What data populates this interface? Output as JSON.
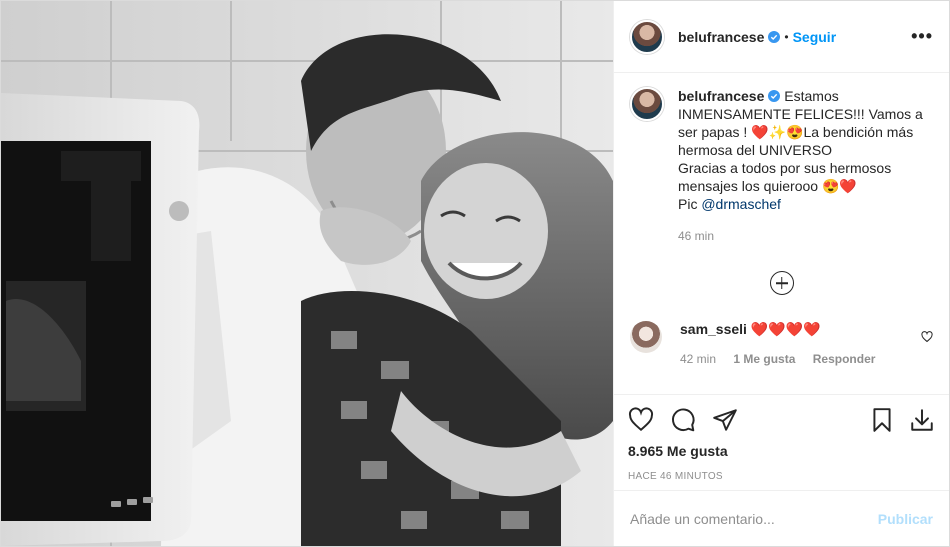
{
  "post": {
    "username": "belufrancese",
    "follow_label": "Seguir",
    "separator": "•",
    "more_icon": "more-horizontal-icon",
    "caption": {
      "username": "belufrancese",
      "text_part1": " Estamos INMENSAMENTE FELICES!!! Vamos a ser papas ! ",
      "emoji1": "❤️✨😍",
      "text_part2": "La bendición más hermosa del UNIVERSO\nGracias a todos por sus hermosos mensajes los quierooo ",
      "emoji2": "😍❤️",
      "pic_label": "\nPic ",
      "mention": "@drmaschef",
      "time": "46 min"
    },
    "comments": [
      {
        "username": "sam_sseli",
        "text": "❤️❤️❤️❤️",
        "time": "42 min",
        "likes": "1 Me gusta",
        "reply_label": "Responder"
      }
    ],
    "likes_label": "8.965 Me gusta",
    "posted_label": "HACE 46 MINUTOS",
    "comment_placeholder": "Añade un comentario...",
    "publish_label": "Publicar"
  },
  "colors": {
    "link_blue": "#0095f6",
    "verified_blue": "#3897f0",
    "publish_disabled": "#b2dffc",
    "muted": "#8e8e8e"
  }
}
